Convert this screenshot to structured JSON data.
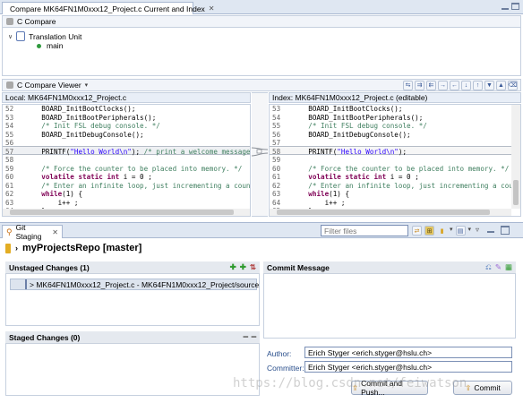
{
  "compare_editor": {
    "tab_title": "Compare MK64FN1M0xxx12_Project.c Current and Index",
    "structure_title": "C Compare",
    "tree": {
      "root": "Translation Unit",
      "child": "main"
    }
  },
  "viewer": {
    "title": "C Compare Viewer",
    "left_header": "Local: MK64FN1M0xxx12_Project.c",
    "right_header": "Index: MK64FN1M0xxx12_Project.c (editable)",
    "left_lines": [
      {
        "n": "52",
        "t": "    BOARD_InitBootClocks();"
      },
      {
        "n": "53",
        "t": "    BOARD_InitBootPeripherals();"
      },
      {
        "n": "54",
        "t": "    /* Init FSL debug console. */"
      },
      {
        "n": "55",
        "t": "    BOARD_InitDebugConsole();"
      },
      {
        "n": "56",
        "t": ""
      },
      {
        "n": "57",
        "t": "    PRINTF(\"Hello World\\n\"); /* print a welcome message */"
      },
      {
        "n": "58",
        "t": ""
      },
      {
        "n": "59",
        "t": "    /* Force the counter to be placed into memory. */"
      },
      {
        "n": "60",
        "t": "    volatile static int i = 0 ;"
      },
      {
        "n": "61",
        "t": "    /* Enter an infinite loop, just incrementing a counter."
      },
      {
        "n": "62",
        "t": "    while(1) {"
      },
      {
        "n": "63",
        "t": "        i++ ;"
      },
      {
        "n": "64",
        "t": "    }"
      }
    ],
    "right_lines": [
      {
        "n": "53",
        "t": "    BOARD_InitBootClocks();"
      },
      {
        "n": "54",
        "t": "    BOARD_InitBootPeripherals();"
      },
      {
        "n": "55",
        "t": "    /* Init FSL debug console. */"
      },
      {
        "n": "56",
        "t": "    BOARD_InitDebugConsole();"
      },
      {
        "n": "57",
        "t": ""
      },
      {
        "n": "58",
        "t": "    PRINTF(\"Hello World\\n\");"
      },
      {
        "n": "59",
        "t": ""
      },
      {
        "n": "60",
        "t": "    /* Force the counter to be placed into memory. */"
      },
      {
        "n": "61",
        "t": "    volatile static int i = 0 ;"
      },
      {
        "n": "62",
        "t": "    /* Enter an infinite loop, just incrementing a count"
      },
      {
        "n": "63",
        "t": "    while(1) {"
      },
      {
        "n": "64",
        "t": "        i++ ;"
      },
      {
        "n": "65",
        "t": "    }"
      }
    ]
  },
  "git_staging": {
    "tab_title": "Git Staging",
    "filter_placeholder": "Filter files",
    "repo": "myProjectsRepo [master]",
    "unstaged_header": "Unstaged Changes (1)",
    "unstaged_item": "> MK64FN1M0xxx12_Project.c - MK64FN1M0xxx12_Project/source",
    "staged_header": "Staged Changes (0)",
    "commit_header": "Commit Message",
    "author_label": "Author:",
    "author_value": "Erich Styger <erich.styger@hslu.ch>",
    "committer_label": "Committer:",
    "committer_value": "Erich Styger <erich.styger@hslu.ch>",
    "commit_push_label": "Commit and Push...",
    "commit_label": "Commit"
  },
  "watermark": "https://blog.csdn.net/feiwatson"
}
